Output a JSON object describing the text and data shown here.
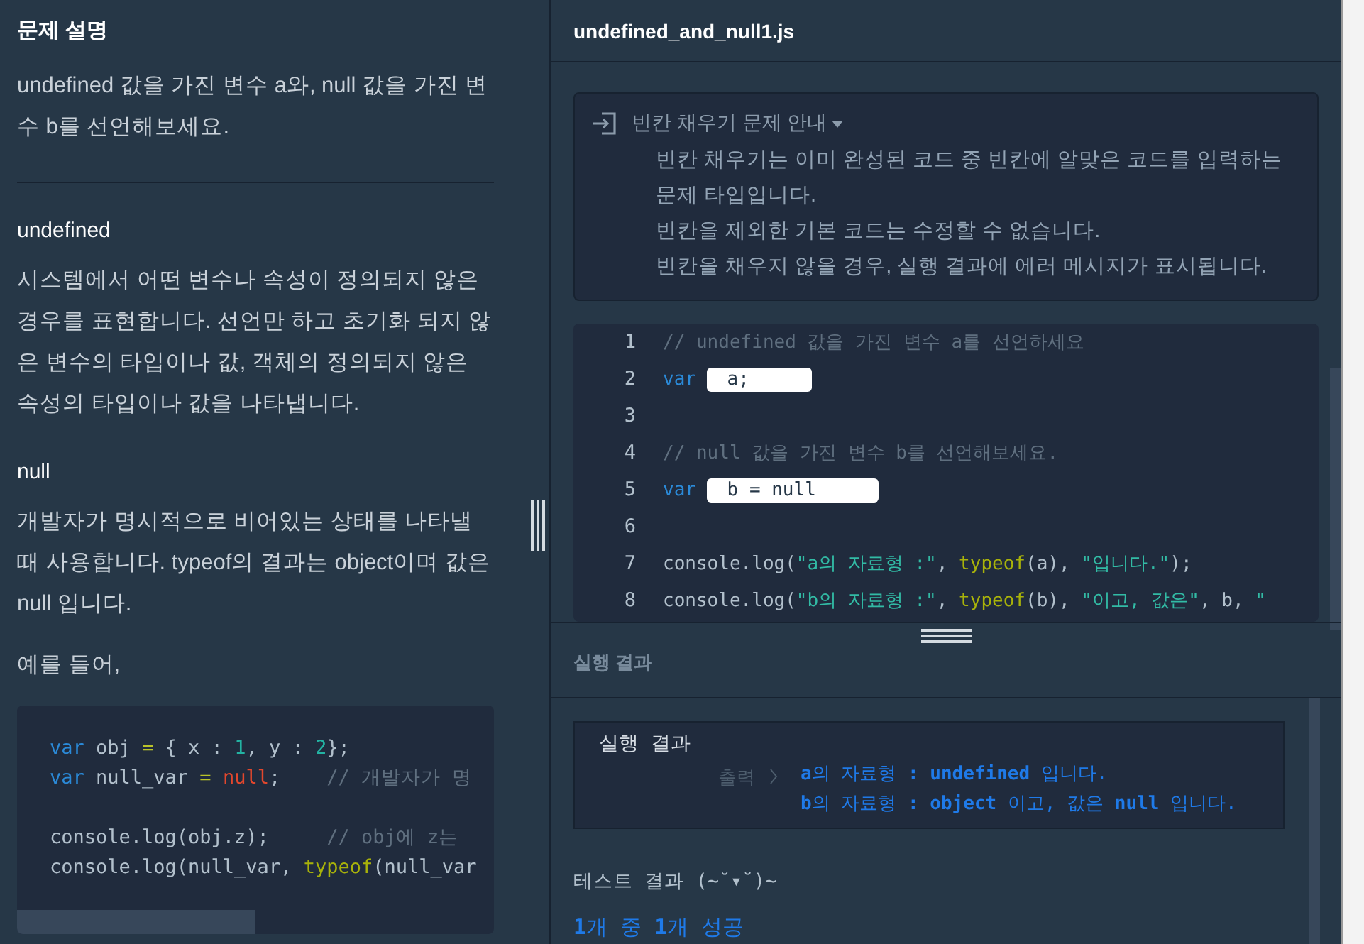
{
  "description": {
    "title": "문제 설명",
    "intro": "undefined 값을 가진 변수 a와, null 값을 가진 변수 b를 선언해보세요.",
    "sections": [
      {
        "heading": "undefined",
        "text": "시스템에서 어떤 변수나 속성이 정의되지 않은 경우를 표현합니다. 선언만 하고 초기화 되지 않은 변수의 타입이나 값, 객체의 정의되지 않은 속성의 타입이나 값을 나타냅니다."
      },
      {
        "heading": "null",
        "text": "개발자가 명시적으로 비어있는 상태를 나타낼 때 사용합니다. typeof의 결과는 object이며 값은 null 입니다."
      }
    ],
    "example_intro": "예를 들어,",
    "example_code": [
      {
        "kind": "code",
        "tokens": [
          {
            "kind": "keyword",
            "text": "var"
          },
          {
            "kind": "plain",
            "text": " obj "
          },
          {
            "kind": "op",
            "text": "="
          },
          {
            "kind": "plain",
            "text": " { x : "
          },
          {
            "kind": "number",
            "text": "1"
          },
          {
            "kind": "plain",
            "text": ", y : "
          },
          {
            "kind": "number",
            "text": "2"
          },
          {
            "kind": "plain",
            "text": "};"
          }
        ]
      },
      {
        "kind": "code",
        "tokens": [
          {
            "kind": "keyword",
            "text": "var"
          },
          {
            "kind": "plain",
            "text": " null_var "
          },
          {
            "kind": "op",
            "text": "="
          },
          {
            "kind": "null",
            "text": "null"
          },
          {
            "kind": "plain",
            "text": ";    "
          },
          {
            "kind": "comment",
            "text": "// 개발자가 명"
          }
        ]
      },
      {
        "kind": "empty"
      },
      {
        "kind": "code",
        "tokens": [
          {
            "kind": "plain",
            "text": "console.log(obj.z);     "
          },
          {
            "kind": "comment",
            "text": "// obj에 z는"
          }
        ]
      },
      {
        "kind": "code",
        "tokens": [
          {
            "kind": "plain",
            "text": "console.log(null_var, "
          },
          {
            "kind": "func",
            "text": "typeof"
          },
          {
            "kind": "plain",
            "text": "(null_var"
          }
        ]
      }
    ]
  },
  "editor": {
    "file_name": "undefined_and_null1.js",
    "guide": {
      "title": "빈칸 채우기 문제 안내",
      "expanded": true,
      "lines": [
        "빈칸 채우기는 이미 완성된 코드 중 빈칸에 알맞은 코드를 입력하는 문제 타입입니다.",
        "빈칸을 제외한 기본 코드는 수정할 수 없습니다.",
        "빈칸을 채우지 않을 경우, 실행 결과에 에러 메시지가 표시됩니다."
      ]
    },
    "lines": [
      {
        "number": "1",
        "kind": "code",
        "tokens": [
          {
            "kind": "comment",
            "text": "// undefined 값을 가진 변수 a를 선언하세요"
          }
        ]
      },
      {
        "number": "2",
        "kind": "code",
        "tokens": [
          {
            "kind": "keyword",
            "text": "var"
          },
          {
            "kind": "blank",
            "text": "a;"
          }
        ]
      },
      {
        "number": "3",
        "kind": "empty"
      },
      {
        "number": "4",
        "kind": "code",
        "tokens": [
          {
            "kind": "comment",
            "text": "// null 값을 가진 변수 b를 선언해보세요."
          }
        ]
      },
      {
        "number": "5",
        "kind": "code",
        "tokens": [
          {
            "kind": "keyword",
            "text": "var"
          },
          {
            "kind": "blank",
            "text": "b = null"
          }
        ]
      },
      {
        "number": "6",
        "kind": "empty"
      },
      {
        "number": "7",
        "kind": "code",
        "tokens": [
          {
            "kind": "plain",
            "text": "console.log("
          },
          {
            "kind": "string",
            "text": "\"a의 자료형 :\""
          },
          {
            "kind": "plain",
            "text": ", "
          },
          {
            "kind": "func",
            "text": "typeof"
          },
          {
            "kind": "plain",
            "text": "(a), "
          },
          {
            "kind": "string",
            "text": "\"입니다.\""
          },
          {
            "kind": "plain",
            "text": ");"
          }
        ]
      },
      {
        "number": "8",
        "kind": "code",
        "tokens": [
          {
            "kind": "plain",
            "text": "console.log("
          },
          {
            "kind": "string",
            "text": "\"b의 자료형 :\""
          },
          {
            "kind": "plain",
            "text": ", "
          },
          {
            "kind": "func",
            "text": "typeof"
          },
          {
            "kind": "plain",
            "text": "(b), "
          },
          {
            "kind": "string",
            "text": "\"이고, 값은\""
          },
          {
            "kind": "plain",
            "text": ", b, "
          },
          {
            "kind": "string",
            "text": "\""
          }
        ]
      }
    ]
  },
  "results": {
    "section_title": "실행 결과",
    "output": {
      "title": "실행 결과",
      "prompt": "출력",
      "lines": [
        "**a**의 자료형 **: undefined** 입니다.",
        "**b**의 자료형 **: object** 이고, 값은 **null** 입니다."
      ]
    },
    "test": {
      "title": "테스트 결과 (~˘▾˘)~",
      "summary": "**1**개 중 **1**개 성공"
    }
  }
}
